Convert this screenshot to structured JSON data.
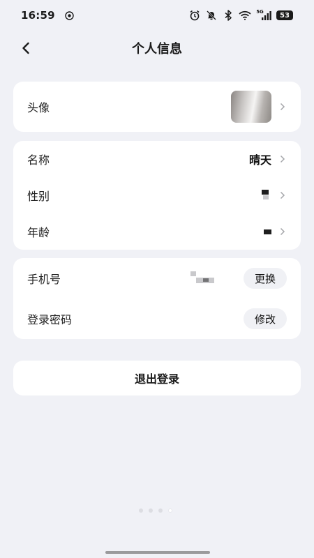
{
  "status_bar": {
    "time": "16:59",
    "network": "5G",
    "battery": "53"
  },
  "header": {
    "title": "个人信息"
  },
  "profile_card": {
    "avatar_label": "头像"
  },
  "basic_card": {
    "name_label": "名称",
    "name_value": "晴天",
    "gender_label": "性别",
    "age_label": "年龄"
  },
  "account_card": {
    "phone_label": "手机号",
    "phone_action": "更换",
    "password_label": "登录密码",
    "password_action": "修改"
  },
  "logout": {
    "label": "退出登录"
  },
  "pager": {
    "total": 4,
    "active_index": 3
  },
  "colors": {
    "background": "#f0f1f6",
    "card": "#ffffff",
    "pill_button": "#f0f1f5"
  }
}
